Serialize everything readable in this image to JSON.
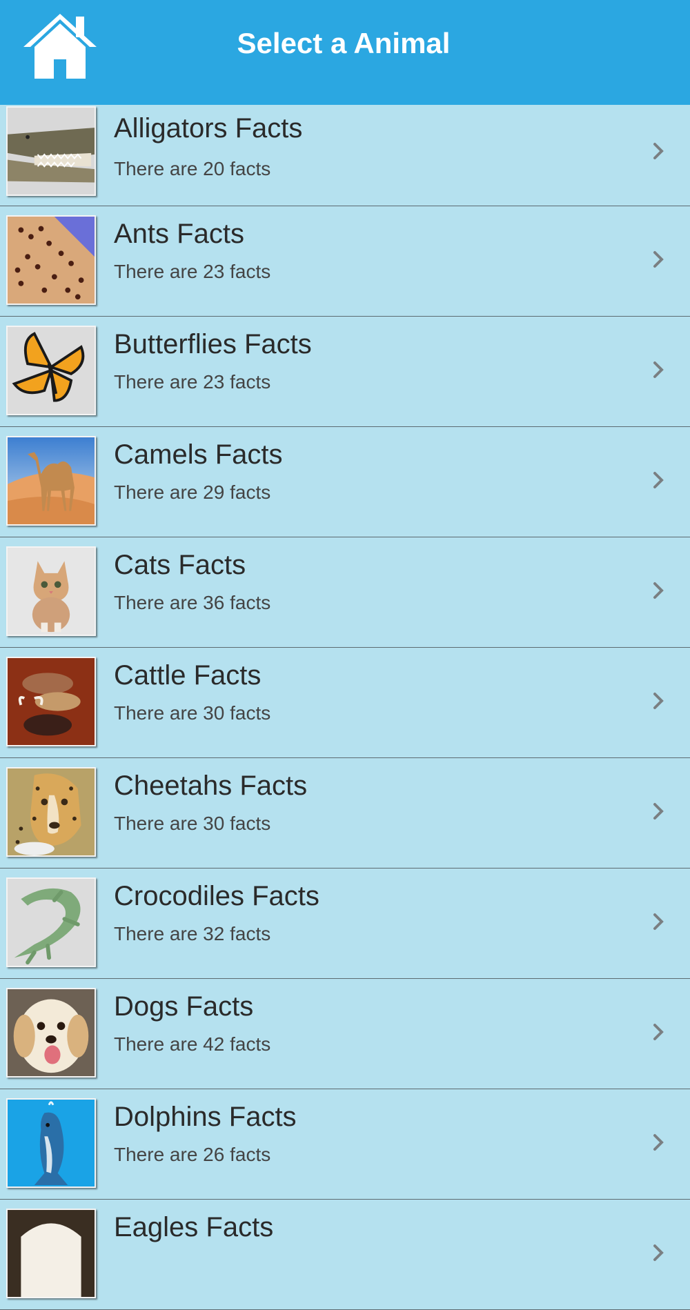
{
  "header": {
    "title": "Select a Animal",
    "home_icon": "home-icon",
    "background": "#2ba7e1"
  },
  "list": {
    "background": "#b5e1ef",
    "items": [
      {
        "title": "Alligators Facts",
        "subtitle": "There are 20 facts",
        "icon": "alligator-thumbnail"
      },
      {
        "title": "Ants Facts",
        "subtitle": "There are 23 facts",
        "icon": "ants-thumbnail"
      },
      {
        "title": "Butterflies Facts",
        "subtitle": "There are 23 facts",
        "icon": "butterfly-thumbnail"
      },
      {
        "title": "Camels Facts",
        "subtitle": "There are 29 facts",
        "icon": "camel-thumbnail"
      },
      {
        "title": "Cats Facts",
        "subtitle": "There are 36 facts",
        "icon": "cat-thumbnail"
      },
      {
        "title": "Cattle Facts",
        "subtitle": "There are 30 facts",
        "icon": "cattle-thumbnail"
      },
      {
        "title": "Cheetahs Facts",
        "subtitle": "There are 30 facts",
        "icon": "cheetah-thumbnail"
      },
      {
        "title": "Crocodiles Facts",
        "subtitle": "There are 32 facts",
        "icon": "crocodile-thumbnail"
      },
      {
        "title": "Dogs Facts",
        "subtitle": "There are 42 facts",
        "icon": "dog-thumbnail"
      },
      {
        "title": "Dolphins Facts",
        "subtitle": "There are 26 facts",
        "icon": "dolphin-thumbnail"
      },
      {
        "title": "Eagles Facts",
        "subtitle": "",
        "icon": "eagle-thumbnail"
      }
    ]
  }
}
